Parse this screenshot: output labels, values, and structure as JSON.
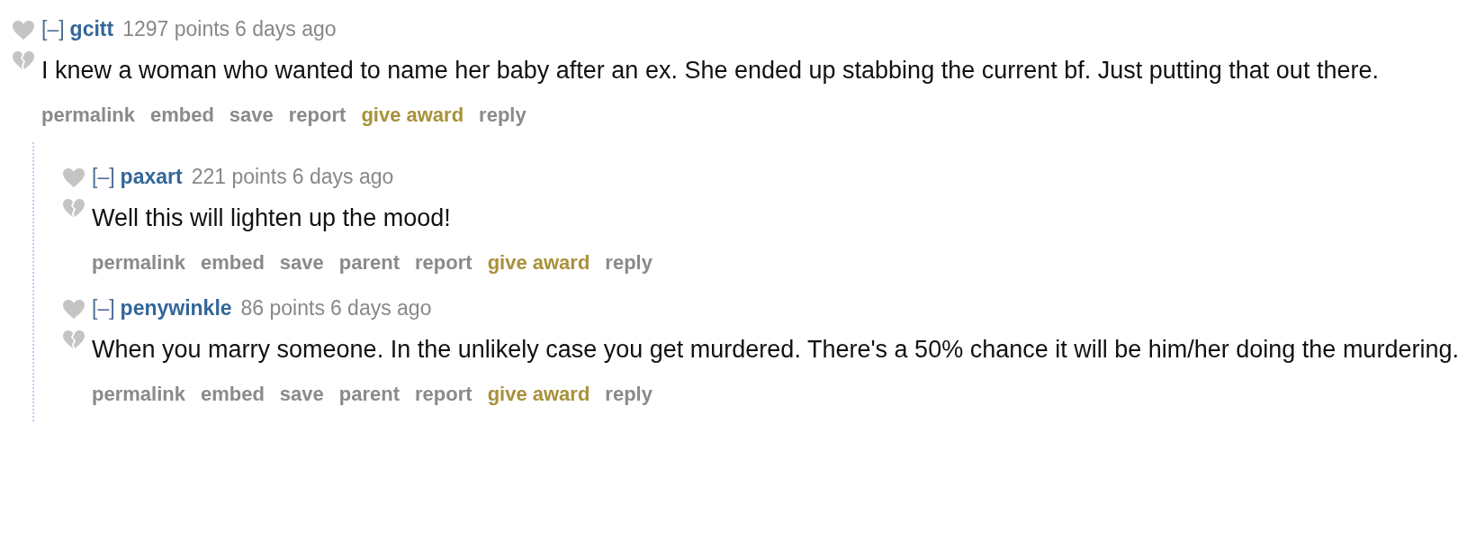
{
  "comments": [
    {
      "toggle": "[–]",
      "author": "gcitt",
      "score": "1297 points",
      "time": "6 days ago",
      "body": "I knew a woman who wanted to name her baby after an ex. She ended up stabbing the current bf. Just putting that out there.",
      "actions": [
        {
          "label": "permalink",
          "kind": "link"
        },
        {
          "label": "embed",
          "kind": "link"
        },
        {
          "label": "save",
          "kind": "link"
        },
        {
          "label": "report",
          "kind": "link"
        },
        {
          "label": "give award",
          "kind": "award"
        },
        {
          "label": "reply",
          "kind": "link"
        }
      ],
      "children": [
        {
          "toggle": "[–]",
          "author": "paxart",
          "score": "221 points",
          "time": "6 days ago",
          "body": "Well this will lighten up the mood!",
          "actions": [
            {
              "label": "permalink",
              "kind": "link"
            },
            {
              "label": "embed",
              "kind": "link"
            },
            {
              "label": "save",
              "kind": "link"
            },
            {
              "label": "parent",
              "kind": "link"
            },
            {
              "label": "report",
              "kind": "link"
            },
            {
              "label": "give award",
              "kind": "award"
            },
            {
              "label": "reply",
              "kind": "link"
            }
          ]
        },
        {
          "toggle": "[–]",
          "author": "penywinkle",
          "score": "86 points",
          "time": "6 days ago",
          "body": "When you marry someone. In the unlikely case you get murdered. There's a 50% chance it will be him/her doing the murdering.",
          "actions": [
            {
              "label": "permalink",
              "kind": "link"
            },
            {
              "label": "embed",
              "kind": "link"
            },
            {
              "label": "save",
              "kind": "link"
            },
            {
              "label": "parent",
              "kind": "link"
            },
            {
              "label": "report",
              "kind": "link"
            },
            {
              "label": "give award",
              "kind": "award"
            },
            {
              "label": "reply",
              "kind": "link"
            }
          ]
        }
      ]
    }
  ]
}
